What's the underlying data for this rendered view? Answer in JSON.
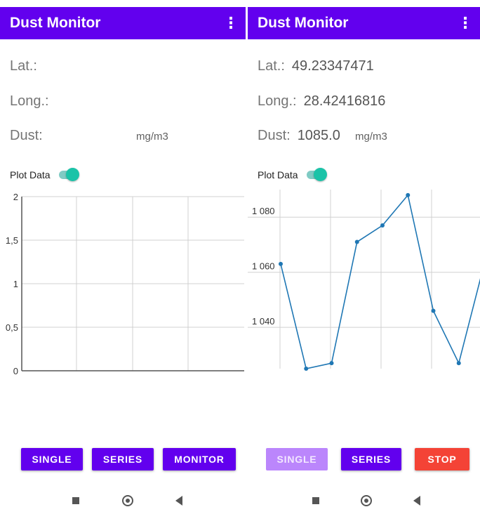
{
  "screens": [
    {
      "app_title": "Dust Monitor",
      "menu_icon": "more-vert-icon",
      "lat_label": "Lat.:",
      "lat_value": "",
      "long_label": "Long.:",
      "long_value": "",
      "dust_label": "Dust:",
      "dust_value": "",
      "dust_unit": "mg/m3",
      "plot_label": "Plot Data",
      "plot_enabled": true,
      "buttons": {
        "single": "SINGLE",
        "series": "SERIES",
        "monitor": "MONITOR"
      },
      "nav_icons": [
        "recents-square-icon",
        "home-circle-icon",
        "back-triangle-icon"
      ]
    },
    {
      "app_title": "Dust Monitor",
      "menu_icon": "more-vert-icon",
      "lat_label": "Lat.:",
      "lat_value": "49.23347471",
      "long_label": "Long.:",
      "long_value": "28.42416816",
      "dust_label": "Dust:",
      "dust_value": "1085.0",
      "dust_unit": "mg/m3",
      "plot_label": "Plot Data",
      "plot_enabled": true,
      "buttons": {
        "single": "SINGLE",
        "series": "SERIES",
        "stop": "STOP"
      },
      "nav_icons": [
        "recents-square-icon",
        "home-circle-icon",
        "back-triangle-icon"
      ]
    }
  ],
  "colors": {
    "primary": "#6200ee",
    "primary_disabled": "#bb86fc",
    "stop": "#f44336",
    "switch_on": "#1bc3a8",
    "line": "#1f77b4"
  },
  "chart_data": [
    {
      "type": "line",
      "yticks": [
        "0",
        "0,5",
        "1",
        "1,5",
        "2"
      ],
      "y_tick_values": [
        0,
        0.5,
        1,
        1.5,
        2
      ],
      "ylim": [
        0,
        2
      ],
      "vertical_grid_lines": 4,
      "series": [
        {
          "values": []
        }
      ]
    },
    {
      "type": "line",
      "yticks": [
        "1 040",
        "1 060",
        "1 080"
      ],
      "y_tick_values": [
        1040,
        1060,
        1080
      ],
      "ylim": [
        1025,
        1090
      ],
      "vertical_grid_lines": 4,
      "series": [
        {
          "values": [
            1063,
            1025,
            1027,
            1071,
            1077,
            1088,
            1046,
            1027,
            1063
          ]
        }
      ]
    }
  ]
}
